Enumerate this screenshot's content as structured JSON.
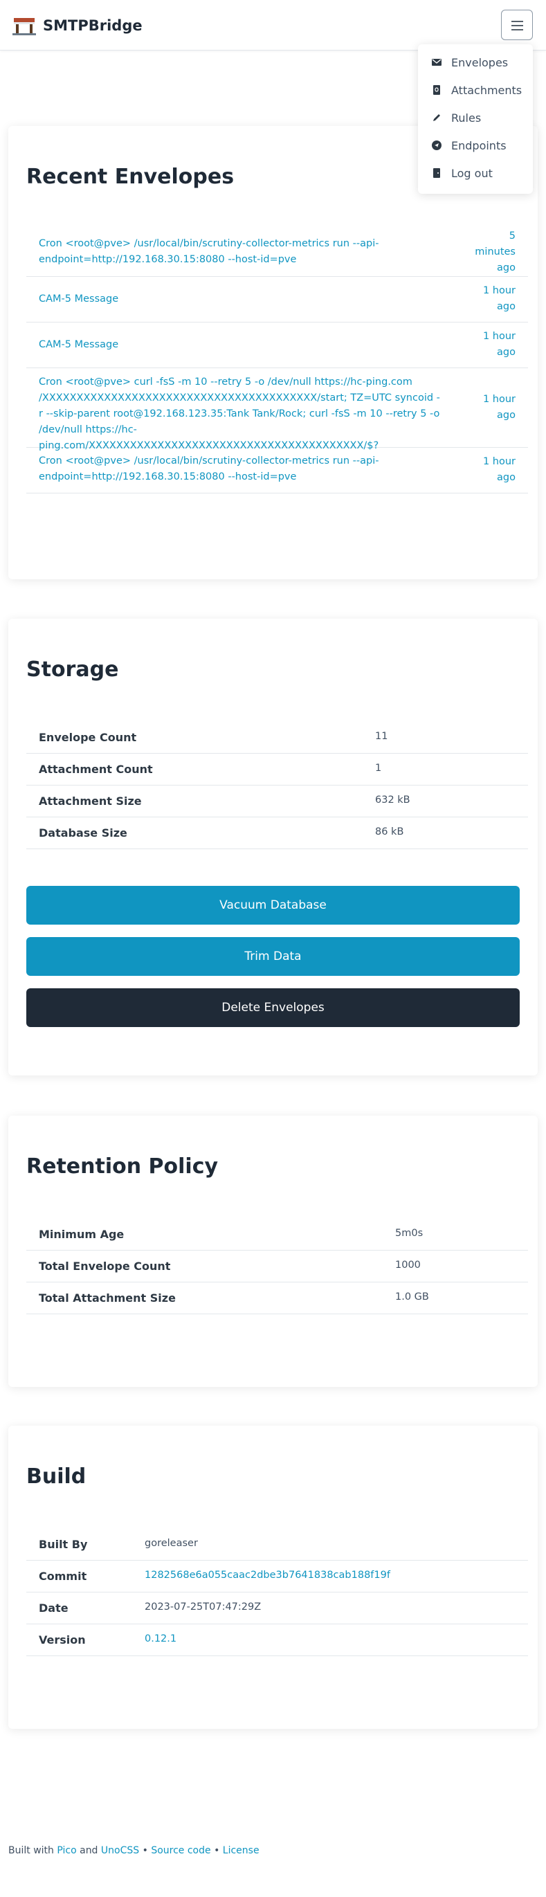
{
  "app": {
    "name": "SMTPBridge"
  },
  "nav": {
    "menu": [
      {
        "label": "Envelopes",
        "icon": "envelope-icon"
      },
      {
        "label": "Attachments",
        "icon": "attachment-file-icon"
      },
      {
        "label": "Rules",
        "icon": "pencil-icon"
      },
      {
        "label": "Endpoints",
        "icon": "send-icon"
      },
      {
        "label": "Log out",
        "icon": "door-icon"
      }
    ]
  },
  "recent": {
    "title": "Recent Envelopes",
    "items": [
      {
        "subject": "Cron <root@pve> /usr/local/bin/scrutiny-collector-metrics run --api-endpoint=http://192.168.30.15:8080 --host-id=pve",
        "time": "5 minutes ago"
      },
      {
        "subject": "CAM-5 Message",
        "time": "1 hour ago"
      },
      {
        "subject": "CAM-5 Message",
        "time": "1 hour ago"
      },
      {
        "subject": "Cron <root@pve> curl -fsS -m 10 --retry 5 -o /dev/null https://hc-ping.com /XXXXXXXXXXXXXXXXXXXXXXXXXXXXXXXXXXXXXXXX/start; TZ=UTC syncoid -r --skip-parent root@192.168.123.35:Tank Tank/Rock; curl -fsS -m 10 --retry 5 -o /dev/null https://hc-ping.com/XXXXXXXXXXXXXXXXXXXXXXXXXXXXXXXXXXXXXXXX/$?",
        "time": "1 hour ago"
      },
      {
        "subject": "Cron <root@pve> /usr/local/bin/scrutiny-collector-metrics run --api-endpoint=http://192.168.30.15:8080 --host-id=pve",
        "time": "1 hour ago"
      }
    ]
  },
  "storage": {
    "title": "Storage",
    "rows": [
      {
        "key": "Envelope Count",
        "value": "11"
      },
      {
        "key": "Attachment Count",
        "value": "1"
      },
      {
        "key": "Attachment Size",
        "value": "632 kB"
      },
      {
        "key": "Database Size",
        "value": "86 kB"
      }
    ],
    "buttons": {
      "vacuum": "Vacuum Database",
      "trim": "Trim Data",
      "delete": "Delete Envelopes"
    }
  },
  "retention": {
    "title": "Retention Policy",
    "rows": [
      {
        "key": "Minimum Age",
        "value": "5m0s"
      },
      {
        "key": "Total Envelope Count",
        "value": "1000"
      },
      {
        "key": "Total Attachment Size",
        "value": "1.0 GB"
      }
    ]
  },
  "build": {
    "title": "Build",
    "rows": [
      {
        "key": "Built By",
        "value": "goreleaser"
      },
      {
        "key": "Commit",
        "value": "1282568e6a055caac2dbe3b7641838cab188f19f"
      },
      {
        "key": "Date",
        "value": "2023-07-25T07:47:29Z"
      },
      {
        "key": "Version",
        "value": "0.12.1"
      }
    ]
  },
  "footer": {
    "built_with": "Built with",
    "pico": "Pico",
    "and": "and",
    "unocss": "UnoCSS",
    "sep": "•",
    "source": "Source code",
    "license": "License"
  },
  "colors": {
    "accent": "#1095c1",
    "dark": "#1f2a37"
  }
}
